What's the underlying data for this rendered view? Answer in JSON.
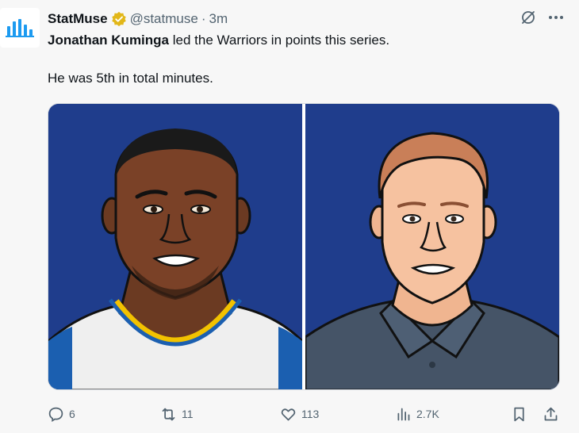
{
  "tweet": {
    "author_name": "StatMuse",
    "handle": "@statmuse",
    "separator": "·",
    "time": "3m",
    "mention": "Jonathan Kuminga",
    "text_line1_rest": " led the Warriors in points this series.",
    "text_line2": "He was 5th in total minutes."
  },
  "actions": {
    "replies": "6",
    "retweets": "11",
    "likes": "113",
    "views": "2.7K"
  },
  "colors": {
    "brand": "#1d9bf0",
    "verified_badge": "#e2b719",
    "panel_background": "#1f3d8c"
  },
  "icons": [
    "statmuse-logo",
    "verified-badge-icon",
    "grok-icon",
    "more-icon",
    "reply-icon",
    "retweet-icon",
    "like-icon",
    "views-icon",
    "bookmark-icon",
    "share-icon"
  ]
}
